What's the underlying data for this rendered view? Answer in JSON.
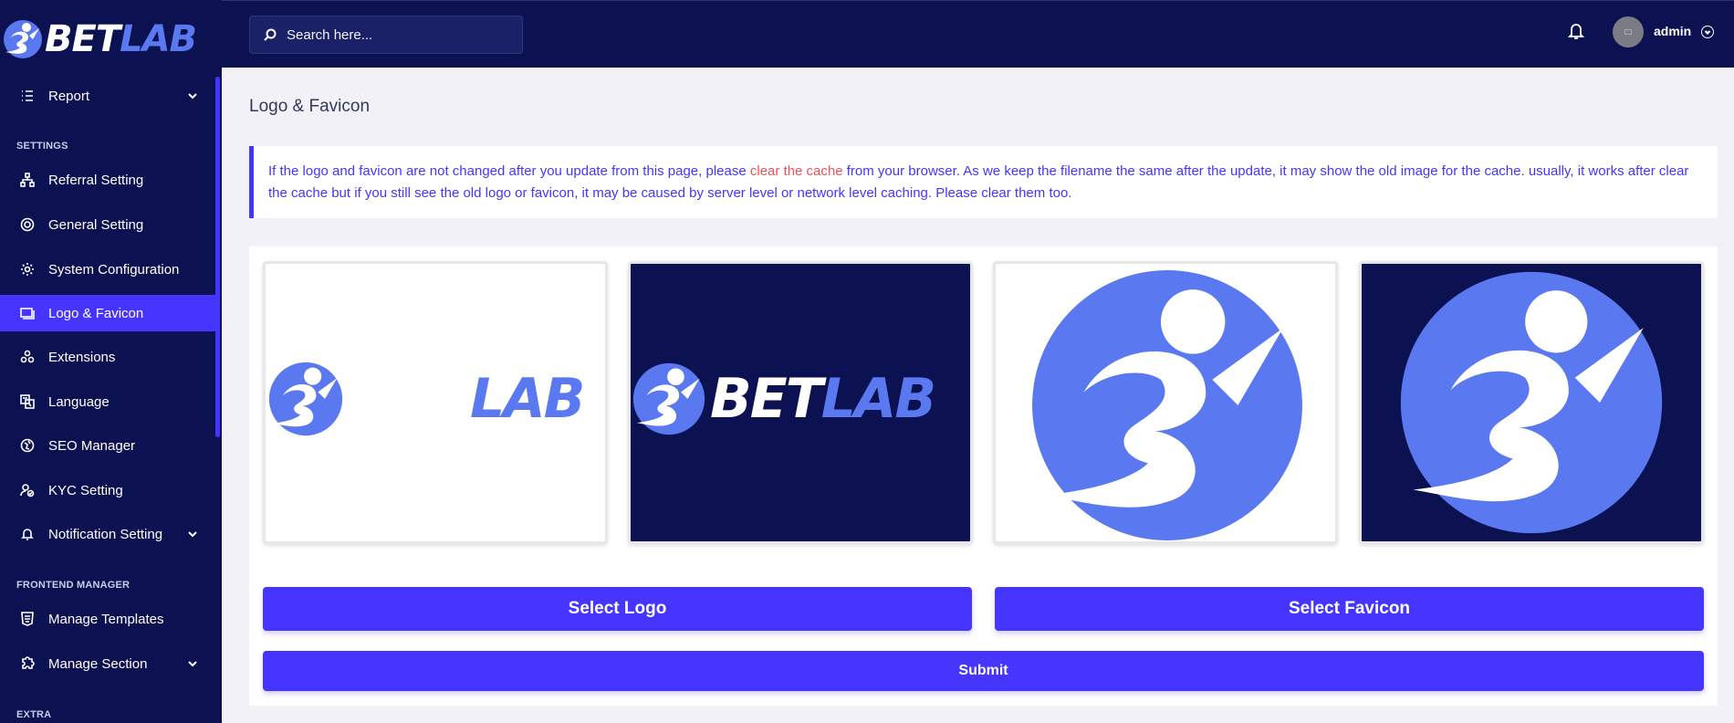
{
  "brand": {
    "name_part1": "BET",
    "name_part2": "LAB"
  },
  "colors": {
    "sidebar_bg": "#0c1251",
    "accent": "#4634ff",
    "logo_blue": "#5a78f0",
    "alert_highlight": "#ea5455"
  },
  "search": {
    "placeholder": "Search here..."
  },
  "user": {
    "name": "admin"
  },
  "sidebar": {
    "report": "Report",
    "settings_title": "SETTINGS",
    "items": [
      {
        "label": "Referral Setting",
        "icon": "sitemap-icon"
      },
      {
        "label": "General Setting",
        "icon": "lifebuoy-icon"
      },
      {
        "label": "System Configuration",
        "icon": "gear-icon"
      },
      {
        "label": "Logo & Favicon",
        "icon": "images-icon",
        "active": true
      },
      {
        "label": "Extensions",
        "icon": "cogs-icon"
      },
      {
        "label": "Language",
        "icon": "language-icon"
      },
      {
        "label": "SEO Manager",
        "icon": "globe-icon"
      },
      {
        "label": "KYC Setting",
        "icon": "user-check-icon"
      },
      {
        "label": "Notification Setting",
        "icon": "bell-icon"
      }
    ],
    "frontend_title": "FRONTEND MANAGER",
    "frontend_items": [
      {
        "label": "Manage Templates",
        "icon": "html5-icon"
      },
      {
        "label": "Manage Section",
        "icon": "puzzle-icon"
      }
    ],
    "extra_title": "EXTRA"
  },
  "page": {
    "title": "Logo & Favicon",
    "alert_part1": "If the logo and favicon are not changed after you update from this page, please ",
    "alert_link": "clear the cache",
    "alert_part2": " from your browser. As we keep the filename the same after the update, it may show the old image for the cache. usually, it works after clear the cache but if you still see the old logo or favicon, it may be caused by server level or network level caching. Please clear them too.",
    "logo_preview_text": "LAB",
    "logo_dark_bet": "BET",
    "logo_dark_lab": "LAB",
    "select_logo": "Select Logo",
    "select_favicon": "Select Favicon",
    "submit": "Submit"
  }
}
